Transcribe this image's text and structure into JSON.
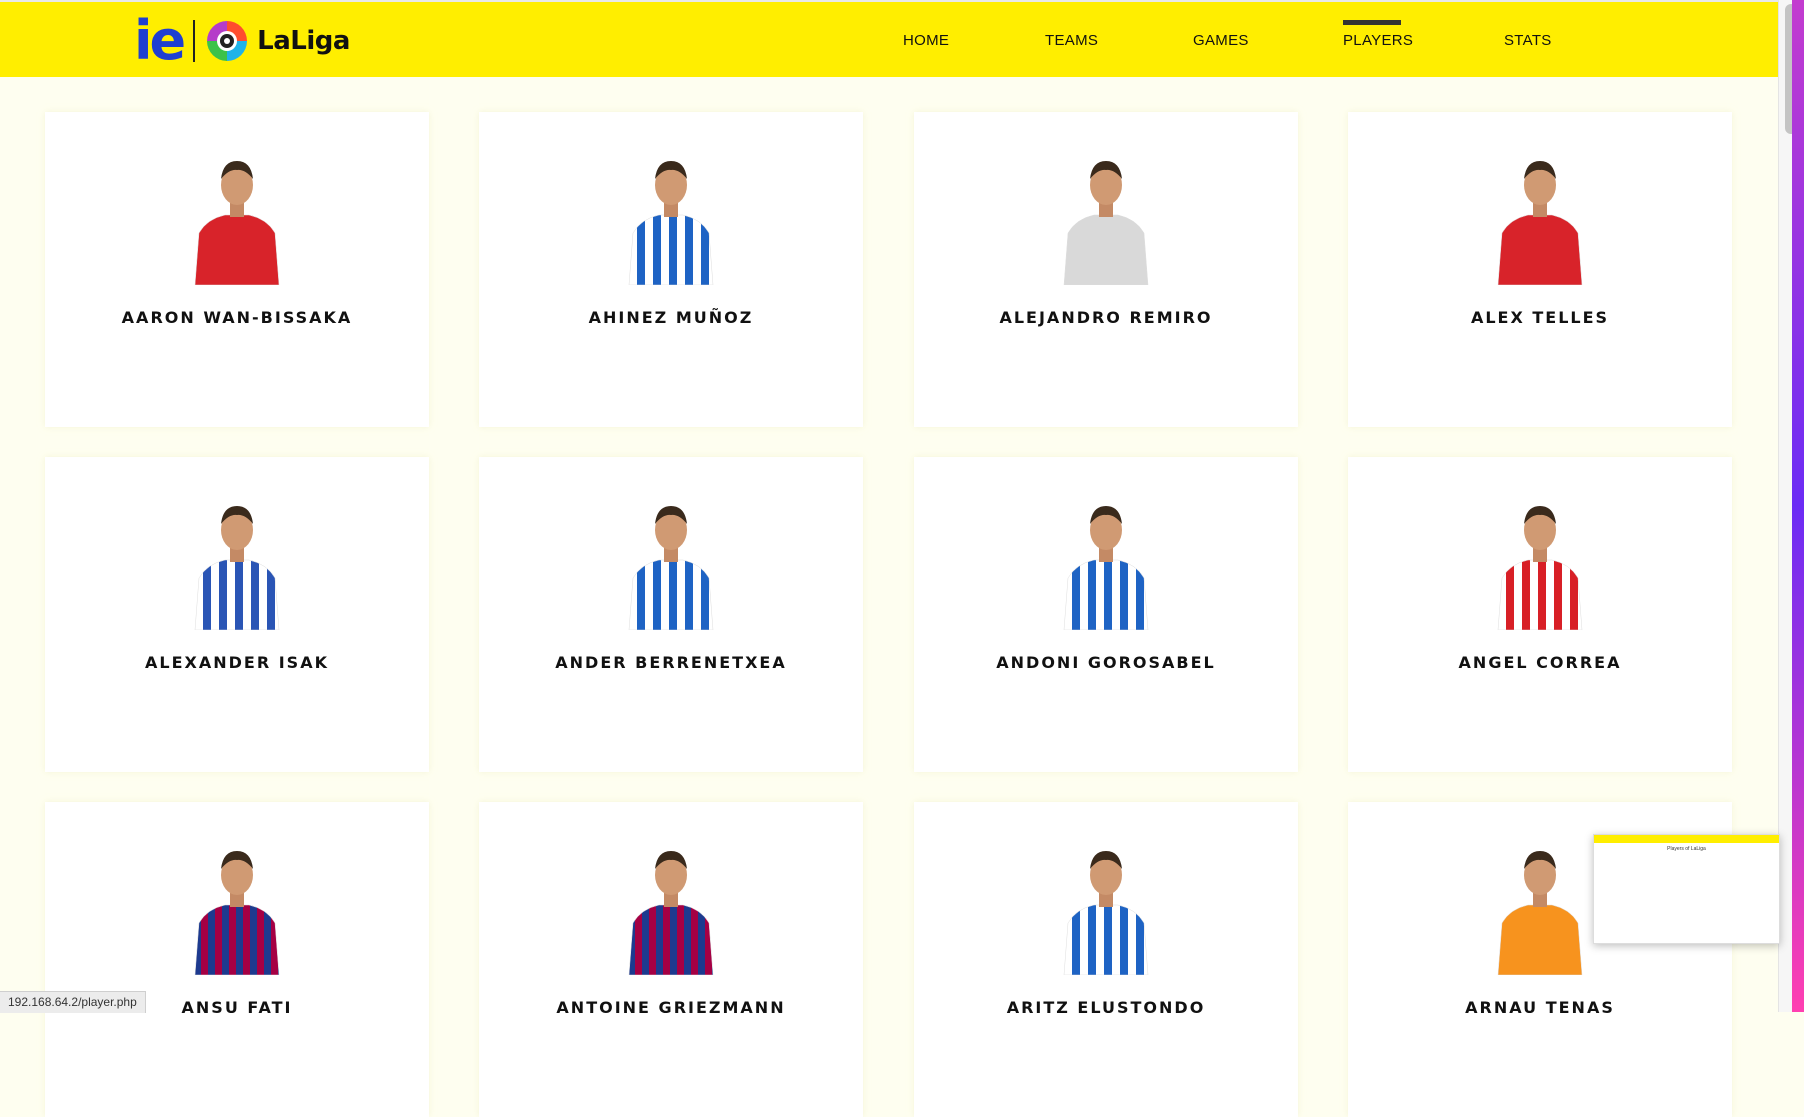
{
  "header": {
    "logo_left": "ie",
    "logo_right": "LaLiga",
    "nav": [
      {
        "label": "HOME",
        "active": false
      },
      {
        "label": "TEAMS",
        "active": false
      },
      {
        "label": "GAMES",
        "active": false
      },
      {
        "label": "PLAYERS",
        "active": true
      },
      {
        "label": "STATS",
        "active": false
      }
    ]
  },
  "players": [
    {
      "name": "AARON WAN-BISSAKA",
      "kit": "manutd-red"
    },
    {
      "name": "AHINEZ MUÑOZ",
      "kit": "realsociedad"
    },
    {
      "name": "ALEJANDRO REMIRO",
      "kit": "goalkeeper-grey"
    },
    {
      "name": "ALEX TELLES",
      "kit": "manutd-red"
    },
    {
      "name": "ALEXANDER ISAK",
      "kit": "realsociedad-away"
    },
    {
      "name": "ANDER BERRENETXEA",
      "kit": "realsociedad"
    },
    {
      "name": "ANDONI GOROSABEL",
      "kit": "realsociedad"
    },
    {
      "name": "ANGEL CORREA",
      "kit": "atletico"
    },
    {
      "name": "ANSU FATI",
      "kit": "barcelona"
    },
    {
      "name": "ANTOINE GRIEZMANN",
      "kit": "barcelona"
    },
    {
      "name": "ARITZ ELUSTONDO",
      "kit": "realsociedad"
    },
    {
      "name": "ARNAU TENAS",
      "kit": "goalkeeper-orange"
    }
  ],
  "colors": {
    "header_bg": "#ffee00",
    "page_bg": "#fefef0",
    "card_bg": "#ffffff",
    "manutd-red": "#d8232a",
    "realsociedad": "#1e63c4",
    "realsociedad-away": "#2a55b5",
    "goalkeeper-grey": "#d9d9d9",
    "atletico": "#d81f26",
    "barcelona": "#a50044",
    "goalkeeper-orange": "#f7931e"
  },
  "status_bar": {
    "url": "192.168.64.2/player.php"
  },
  "thumbnail": {
    "title": "Players of LaLiga"
  }
}
